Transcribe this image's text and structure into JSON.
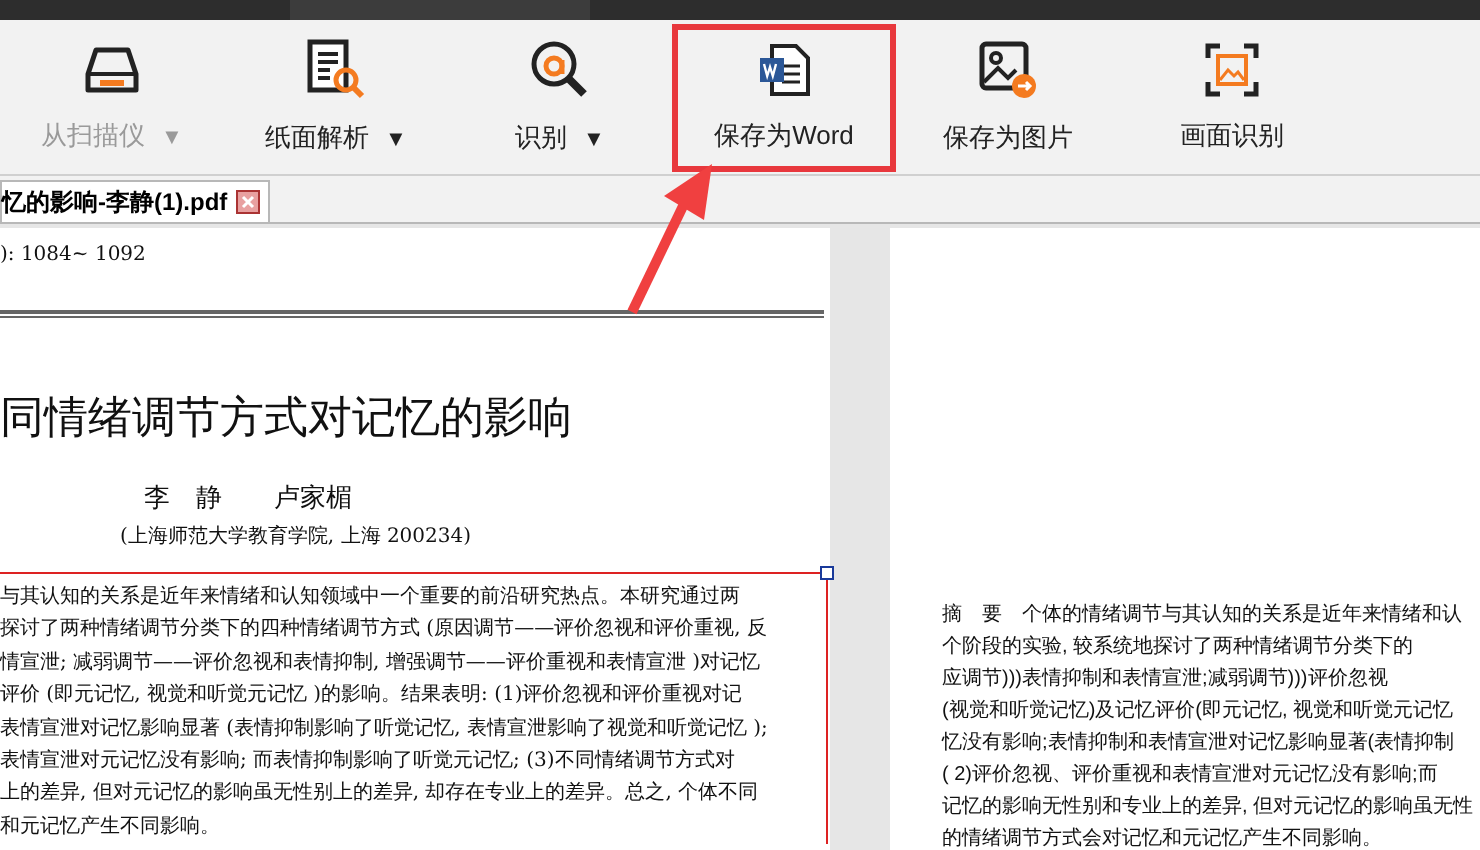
{
  "toolbar": [
    {
      "label": "从扫描仪",
      "dropdown": "▼",
      "disabled": true,
      "highlighted": false,
      "kind": "scanner"
    },
    {
      "label": "纸面解析",
      "dropdown": "▼",
      "disabled": false,
      "highlighted": false,
      "kind": "parse"
    },
    {
      "label": "识别",
      "dropdown": "▼",
      "disabled": false,
      "highlighted": false,
      "kind": "recognize"
    },
    {
      "label": "保存为Word",
      "disabled": false,
      "highlighted": true,
      "kind": "word"
    },
    {
      "label": "保存为图片",
      "disabled": false,
      "highlighted": false,
      "kind": "image"
    },
    {
      "label": "画面识别",
      "disabled": false,
      "highlighted": false,
      "kind": "capture"
    }
  ],
  "tabs": [
    {
      "label": "忆的影响-李静(1).pdf",
      "selected": true
    }
  ],
  "left_page": {
    "header": "): 1084~ 1092",
    "title": "同情绪调节方式对记忆的影响",
    "authors": "李　静　　卢家楣",
    "affiliation": "(上海师范大学教育学院, 上海  200234)",
    "abstract_selected": true,
    "abstract": [
      "与其认知的关系是近年来情绪和认知领域中一个重要的前沿研究热点。本研究通过两",
      "探讨了两种情绪调节分类下的四种情绪调节方式 (原因调节——评价忽视和评价重视, 反",
      "情宣泄; 减弱调节——评价忽视和表情抑制, 增强调节——评价重视和表情宣泄 )对记忆",
      "评价 (即元记忆, 视觉和听觉元记忆 )的影响。结果表明: (1)评价忽视和评价重视对记",
      "表情宣泄对记忆影响显著 (表情抑制影响了听觉记忆, 表情宣泄影响了视觉和听觉记忆 );",
      "表情宣泄对元记忆没有影响; 而表情抑制影响了听觉元记忆; (3)不同情绪调节方式对",
      "上的差异, 但对元记忆的影响虽无性别上的差异, 却存在专业上的差异。总之, 个体不同",
      "和元记忆产生不同影响。"
    ]
  },
  "right_page": {
    "lines": [
      "摘　要　个体的情绪调节与其认知的关系是近年来情绪和认",
      "个阶段的实验, 较系统地探讨了两种情绪调节分类下的",
      "应调节)))表情抑制和表情宣泄;减弱调节)))评价忽视",
      "(视觉和听觉记忆)及记忆评价(即元记忆, 视觉和听觉元记忆",
      "忆没有影响;表情抑制和表情宣泄对记忆影响显著(表情抑制",
      "( 2)评价忽视、评价重视和表情宣泄对元记忆没有影响;而",
      "记忆的影响无性别和专业上的差异, 但对元记忆的影响虽无性",
      "的情绪调节方式会对记忆和元记忆产生不同影响。"
    ]
  }
}
